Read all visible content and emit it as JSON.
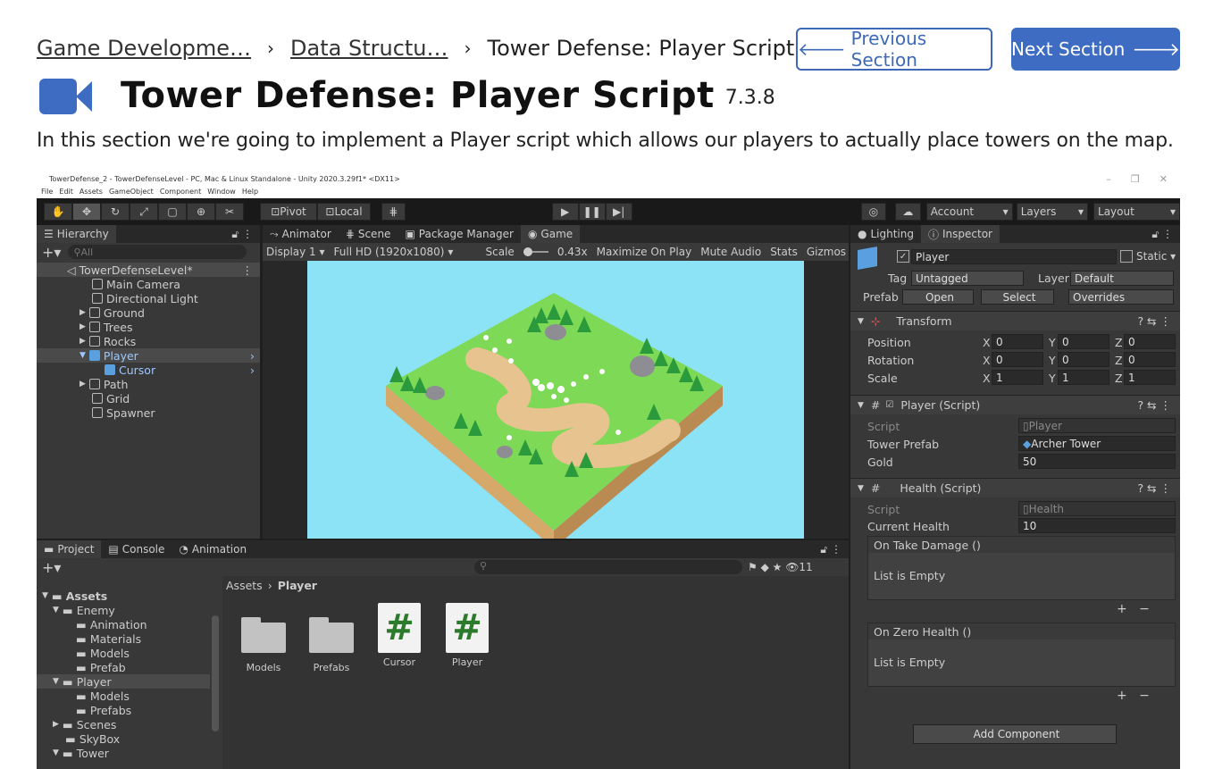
{
  "breadcrumb": {
    "items": [
      "Game Developme…",
      "Data Structu…",
      "Tower Defense: Player Script - …"
    ],
    "separator": "›"
  },
  "nav": {
    "previous_label": "Previous Section",
    "next_label": "Next Section",
    "accent_color": "#3d6cc2"
  },
  "header": {
    "icon": "video-camera-icon",
    "title": "Tower Defense: Player Script",
    "version": "7.3.8"
  },
  "description": "In this section we're going to implement a Player script which allows our players to actually place towers on the map.",
  "unity": {
    "window_title": "TowerDefense_2 - TowerDefenseLevel - PC, Mac & Linux Standalone - Unity 2020.3.29f1* <DX11>",
    "menu": [
      "File",
      "Edit",
      "Assets",
      "GameObject",
      "Component",
      "Window",
      "Help"
    ],
    "toolbar": {
      "pivot": "Pivot",
      "local": "Local",
      "account": "Account",
      "layers": "Layers",
      "layout": "Layout"
    },
    "hierarchy": {
      "tab": "Hierarchy",
      "search_placeholder": "All",
      "scene": "TowerDefenseLevel*",
      "items": [
        "Main Camera",
        "Directional Light",
        "Ground",
        "Trees",
        "Rocks",
        "Player",
        "Cursor",
        "Path",
        "Grid",
        "Spawner"
      ]
    },
    "center_tabs": [
      "Animator",
      "Scene",
      "Package Manager",
      "Game"
    ],
    "game_bar": {
      "display": "Display 1",
      "resolution": "Full HD (1920x1080)",
      "scale_label": "Scale",
      "scale_value": "0.43x",
      "maximize": "Maximize On Play",
      "mute": "Mute Audio",
      "stats": "Stats",
      "gizmos": "Gizmos"
    },
    "inspector": {
      "tabs": [
        "Lighting",
        "Inspector"
      ],
      "object_name": "Player",
      "static_label": "Static",
      "tag_label": "Tag",
      "tag_value": "Untagged",
      "layer_label": "Layer",
      "layer_value": "Default",
      "prefab_label": "Prefab",
      "prefab_open": "Open",
      "prefab_select": "Select",
      "prefab_overrides": "Overrides",
      "transform": {
        "title": "Transform",
        "rows": [
          {
            "label": "Position",
            "x": "0",
            "y": "0",
            "z": "0"
          },
          {
            "label": "Rotation",
            "x": "0",
            "y": "0",
            "z": "0"
          },
          {
            "label": "Scale",
            "x": "1",
            "y": "1",
            "z": "1"
          }
        ]
      },
      "player_script": {
        "title": "Player (Script)",
        "script_label": "Script",
        "script_value": "Player",
        "tower_prefab_label": "Tower Prefab",
        "tower_prefab_value": "Archer Tower",
        "gold_label": "Gold",
        "gold_value": "50"
      },
      "health_script": {
        "title": "Health (Script)",
        "script_label": "Script",
        "script_value": "Health",
        "current_health_label": "Current Health",
        "current_health_value": "10",
        "on_take_damage": "On Take Damage ()",
        "on_zero_health": "On Zero Health ()",
        "list_empty": "List is Empty"
      },
      "add_component": "Add Component"
    },
    "project": {
      "tabs": [
        "Project",
        "Console",
        "Animation"
      ],
      "eye_count": "11",
      "path": [
        "Assets",
        "Player"
      ],
      "tree": [
        "Assets",
        "Enemy",
        "Animation",
        "Materials",
        "Models",
        "Prefab",
        "Player",
        "Models",
        "Prefabs",
        "Scenes",
        "SkyBox",
        "Tower"
      ],
      "assets": [
        {
          "name": "Models",
          "type": "folder"
        },
        {
          "name": "Prefabs",
          "type": "folder"
        },
        {
          "name": "Cursor",
          "type": "script"
        },
        {
          "name": "Player",
          "type": "script"
        }
      ]
    }
  }
}
